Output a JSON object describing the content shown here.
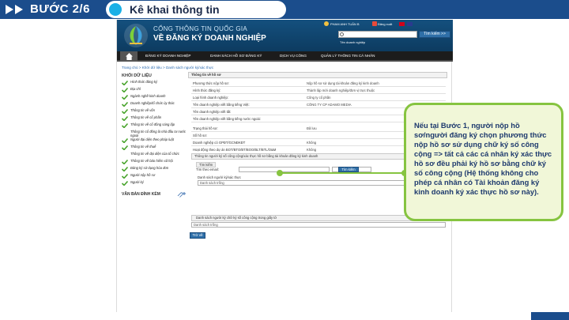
{
  "banner": {
    "step": "BƯỚC 2/6",
    "title": "Kê khai thông tin"
  },
  "header": {
    "portal_name": "CỔNG THÔNG TIN QUỐC GIA",
    "portal_sub": "VỀ ĐĂNG KÝ DOANH NGHIỆP",
    "user": "PHAM ANH TUẤN B",
    "logout": "Đăng xuất",
    "search_placeholder": "",
    "search_button": "Tìm kiếm >>",
    "search_hint": "Tên doanh nghiệp"
  },
  "nav": {
    "items": [
      "ĐĂNG KÝ DOANH NGHIỆP",
      "DANH SÁCH HỒ SƠ ĐĂNG KÝ",
      "DỊCH VỤ CÔNG",
      "QUẢN LÝ THÔNG TIN CÁ NHÂN"
    ]
  },
  "breadcrumb": "Trang chủ > Khởi dữ liệu > Danh sách người ký/xác thực",
  "left": {
    "heading": "KHỐI DỮ LIỆU",
    "items": [
      {
        "label": "Hình thức đăng ký",
        "checked": true
      },
      {
        "label": "Địa chỉ",
        "checked": true
      },
      {
        "label": "Ngành nghề kinh doanh",
        "checked": true
      },
      {
        "label": "Doanh nghiệp/tổ chức ủy thác",
        "checked": true
      },
      {
        "label": "Thông tin về vốn",
        "checked": true
      },
      {
        "label": "Thông tin về cổ phần",
        "checked": true
      },
      {
        "label": "Thông tin về cổ đông sáng lập",
        "checked": true
      },
      {
        "label": "Thông tin cổ đông là nhà đầu tư nước ngoài",
        "checked": false
      },
      {
        "label": "Người đại diện theo pháp luật",
        "checked": true
      },
      {
        "label": "Thông tin về thuế",
        "checked": true
      },
      {
        "label": "Thông tin về đại diện của tổ chức",
        "checked": false
      },
      {
        "label": "Thông tin về bảo hiểm xã hội",
        "checked": true
      },
      {
        "label": "Đăng ký sử dụng hóa đơn",
        "checked": true
      },
      {
        "label": "Người nộp hồ sơ",
        "checked": true
      },
      {
        "label": "Người ký",
        "checked": true
      }
    ],
    "attach_label": "VĂN BẢN ĐÍNH KÈM"
  },
  "content": {
    "info_title": "Thông tin về hồ sơ",
    "fields": [
      {
        "label": "Phương thức nộp hồ sơ:",
        "value": "Nộp hồ sơ sử dụng tài khoản đăng ký kinh doanh"
      },
      {
        "label": "Hình thức đăng ký:",
        "value": "Thành lập mới doanh nghiệp/đơn vị trực thuộc"
      },
      {
        "label": "Loại hình doanh nghiệp:",
        "value": "Công ty cổ phần"
      },
      {
        "label": "Tên doanh nghiệp viết bằng tiếng Việt:",
        "value": "CÔNG TY CP ADAMO MEDIA"
      },
      {
        "label": "Tên doanh nghiệp viết tắt:",
        "value": ""
      },
      {
        "label": "Tên doanh nghiệp viết bằng tiếng nước ngoài:",
        "value": ""
      },
      {
        "label": "Trạng thái hồ sơ:",
        "value": "Đã lưu"
      },
      {
        "label": "Số hồ sơ:",
        "value": ""
      },
      {
        "label": "Doanh nghiệp có GPĐT/GCNĐKĐT",
        "value": "Không"
      },
      {
        "label": "Hoạt động theo dự án BOT/BTO/BT/BOO/BLT/BTL/O&M",
        "value": "Không"
      }
    ],
    "signer_title": "Thông tin người ký số công cộng/xác thực hồ sơ bằng tài khoản đăng ký kinh doanh",
    "search_tab": "Tìm kiếm",
    "search_email_label": "Tìm theo email:",
    "search_btn": "Tìm kiếm",
    "list1_label": "Danh sách người ký/xác thực",
    "list1_empty": "Danh sách trống",
    "list2_label": "Danh sách người ký chữ ký số công cộng trong giấy tờ",
    "list2_empty": "Danh sách trống",
    "back_btn": "Trở về"
  },
  "callout": {
    "text": "Nếu tại Bước 1, người nộp hồ sơ/người đăng ký chọn phương thức nộp hồ sơ sử dụng chữ ký số công cộng => tất cả các cá nhân ký xác thực hồ sơ đều phải ký hồ sơ bằng chữ ký số công cộng (Hệ thống không cho phép cá nhân có Tài khoản đăng ký kinh doanh ký xác thực hồ sơ này)."
  },
  "colors": {
    "banner": "#1b4d8c",
    "accent_green": "#86c440",
    "callout_text": "#1e3a6e"
  }
}
